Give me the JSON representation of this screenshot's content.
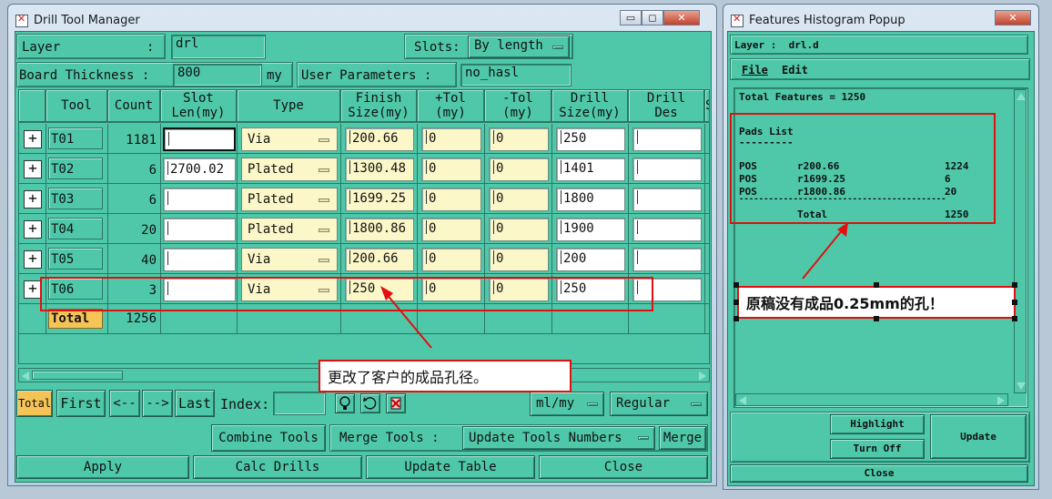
{
  "drill": {
    "title": "Drill Tool Manager",
    "winbtns": {
      "min": "▭",
      "max": "◻",
      "close": "✕"
    },
    "layer_label": "Layer",
    "layer_colon": ":",
    "layer_value": "drl",
    "slots_label": "Slots:",
    "slots_value": "By length",
    "thickness_label": "Board Thickness :",
    "thickness_value": "800",
    "thickness_unit": "my",
    "user_params_label": "User Parameters :",
    "user_params_value": "no_hasl",
    "headers": [
      "Tool",
      "Count",
      "Slot\nLen(my)",
      "Type",
      "Finish\nSize(my)",
      "+Tol\n(my)",
      "-Tol\n(my)",
      "Drill\nSize(my)",
      "Drill\nDes",
      "S"
    ],
    "rows": [
      {
        "tool": "T01",
        "count": "1181",
        "slot": "",
        "type": "Via",
        "finish": "200.66",
        "ptol": "0",
        "mtol": "0",
        "drill": "250"
      },
      {
        "tool": "T02",
        "count": "6",
        "slot": "2700.02",
        "type": "Plated",
        "finish": "1300.48",
        "ptol": "0",
        "mtol": "0",
        "drill": "1401"
      },
      {
        "tool": "T03",
        "count": "6",
        "slot": "",
        "type": "Plated",
        "finish": "1699.25",
        "ptol": "0",
        "mtol": "0",
        "drill": "1800"
      },
      {
        "tool": "T04",
        "count": "20",
        "slot": "",
        "type": "Plated",
        "finish": "1800.86",
        "ptol": "0",
        "mtol": "0",
        "drill": "1900"
      },
      {
        "tool": "T05",
        "count": "40",
        "slot": "",
        "type": "Via",
        "finish": "200.66",
        "ptol": "0",
        "mtol": "0",
        "drill": "200"
      },
      {
        "tool": "T06",
        "count": "3",
        "slot": "",
        "type": "Via",
        "finish": "250",
        "ptol": "0",
        "mtol": "0",
        "drill": "250"
      }
    ],
    "total_label": "Total",
    "total_count": "1256",
    "nav": {
      "total": "Total",
      "first": "First",
      "prev": "<--",
      "next": "-->",
      "last": "Last",
      "index": "Index:"
    },
    "units_value": "ml/my",
    "mode_value": "Regular",
    "combine_tools": "Combine Tools",
    "merge_tools_label": "Merge Tools :",
    "merge_mode": "Update Tools Numbers",
    "merge": "Merge",
    "apply": "Apply",
    "calc_drills": "Calc Drills",
    "update_table": "Update Table",
    "close": "Close",
    "annotation": "更改了客户的成品孔径。"
  },
  "hist": {
    "title": "Features Histogram Popup",
    "layer_line": "Layer :  drl.d",
    "menu": [
      "File",
      "Edit"
    ],
    "total_features": "Total Features = 1250",
    "pads_list": "Pads List",
    "pads_underline": "---------",
    "pads": [
      {
        "kind": "POS",
        "size": "r200.66",
        "count": "1224"
      },
      {
        "kind": "POS",
        "size": "r1699.25",
        "count": "6"
      },
      {
        "kind": "POS",
        "size": "r1800.86",
        "count": "20"
      }
    ],
    "separator": "------------------------------------------",
    "total_label": "Total",
    "total_value": "1250",
    "highlight": "Highlight",
    "turn_off": "Turn Off",
    "update": "Update",
    "close": "Close",
    "annotation": "原稿没有成品0.25mm的孔！"
  }
}
